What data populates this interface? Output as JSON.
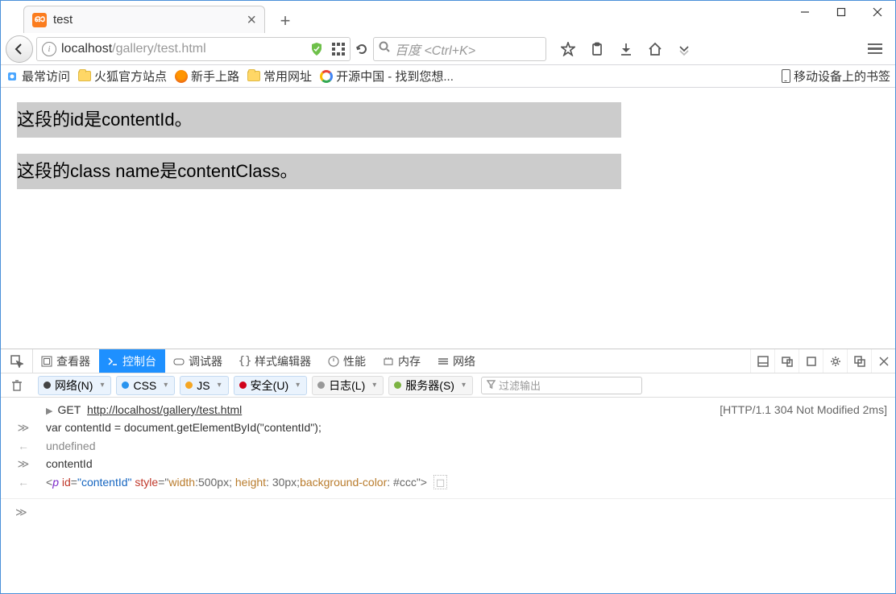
{
  "window": {
    "tab_title": "test"
  },
  "nav": {
    "url_host": "localhost",
    "url_path": "/gallery/test.html",
    "search_placeholder": "百度 <Ctrl+K>"
  },
  "bookmarks": {
    "most_visited": "最常访问",
    "firefox_official": "火狐官方站点",
    "getting_started": "新手上路",
    "common_urls": "常用网址",
    "oschina": "开源中国 - 找到您想...",
    "mobile_bookmarks": "移动设备上的书签"
  },
  "page": {
    "p1": "这段的id是contentId。",
    "p2": "这段的class name是contentClass。"
  },
  "devtools": {
    "tabs": {
      "inspector": "查看器",
      "console": "控制台",
      "debugger": "调试器",
      "style": "样式编辑器",
      "perf": "性能",
      "memory": "内存",
      "network": "网络"
    },
    "filters": {
      "net": "网络(N)",
      "css": "CSS",
      "js": "JS",
      "security": "安全(U)",
      "log": "日志(L)",
      "server": "服务器(S)",
      "placeholder": "过滤输出"
    },
    "log": {
      "get": "GET",
      "url": "http://localhost/gallery/test.html",
      "status": "[HTTP/1.1 304 Not Modified 2ms]",
      "line1": "var contentId = document.getElementById(\"contentId\");",
      "line2": "undefined",
      "line3": "contentId",
      "out_tag": "p",
      "out_id_attr": "id",
      "out_id_val": "\"contentId\"",
      "out_style_attr": "style",
      "out_style_val": "\"width:500px; height: 30px;background-color: #ccc\""
    }
  }
}
